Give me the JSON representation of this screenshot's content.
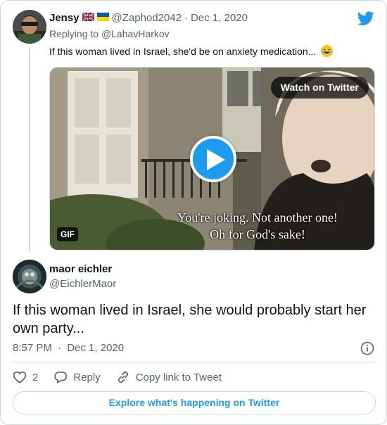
{
  "parent_tweet": {
    "name": "Jensy",
    "flags": [
      "uk-flag",
      "ukraine-flag"
    ],
    "handle": "@Zaphod2042",
    "date": "Dec 1, 2020",
    "replying_prefix": "Replying to ",
    "replying_to": "@LahavHarkov",
    "text": "If this woman lived in Israel, she'd be on anxiety medication...",
    "emoji": "rolling-on-the-floor-laughing",
    "media": {
      "watch_label": "Watch on Twitter",
      "gif_label": "GIF",
      "subtitle_line1": "You're joking. Not another one!",
      "subtitle_line2": "Oh for God's sake!"
    }
  },
  "main_tweet": {
    "name": "maor eichler",
    "handle": "@EichlerMaor",
    "text": "If this woman lived in Israel, she would probably start her own party...",
    "time": "8:57 PM",
    "date": "Dec 1, 2020",
    "like_count": "2",
    "reply_label": "Reply",
    "copy_label": "Copy link to Tweet",
    "explore_label": "Explore what's happening on Twitter"
  },
  "colors": {
    "accent": "#1d9bf0",
    "text": "#0f1419",
    "secondary": "#536471",
    "border": "#cfd9de"
  },
  "icons": [
    "twitter-logo-icon",
    "play-icon",
    "info-icon",
    "heart-icon",
    "reply-bubble-icon",
    "link-icon"
  ]
}
